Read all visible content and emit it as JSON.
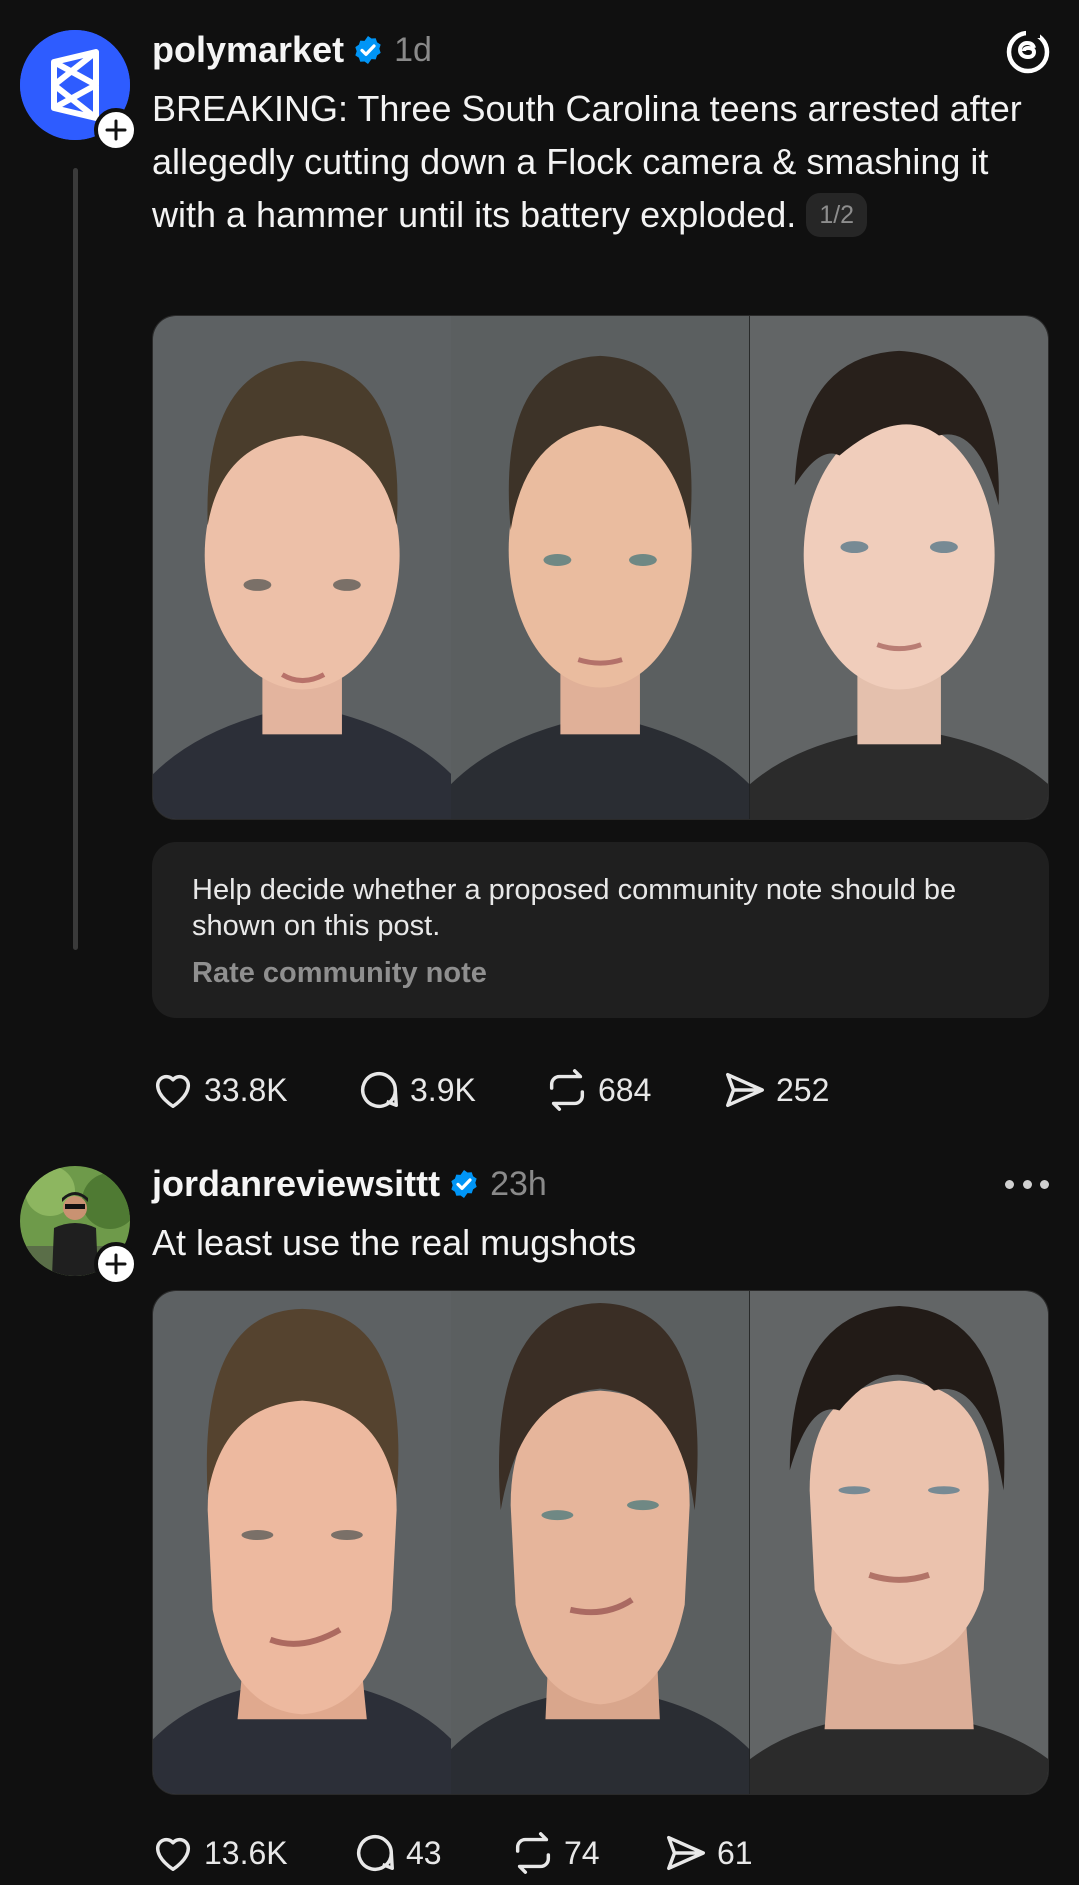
{
  "posts": [
    {
      "username": "polymarket",
      "time": "1d",
      "text": "BREAKING: Three South Carolina teens arrested after allegedly cutting down a Flock camera & smashing it with a hammer until its battery exploded.",
      "pager": "1/2",
      "community_note": {
        "text": "Help decide whether a proposed community note should be shown on this post.",
        "link": "Rate community note"
      },
      "stats": {
        "likes": "33.8K",
        "replies": "3.9K",
        "reposts": "684",
        "shares": "252"
      }
    },
    {
      "username": "jordanreviewsittt",
      "time": "23h",
      "text": "At least use the real mugshots",
      "stats": {
        "likes": "13.6K",
        "replies": "43",
        "reposts": "74",
        "shares": "61"
      }
    }
  ],
  "colors": {
    "background": "#101010",
    "verified": "#0095f6",
    "polymarket_brand": "#2e5cff",
    "muted": "#8a8a8a"
  },
  "icons": [
    "threads-logo-icon",
    "verified-badge-icon",
    "follow-plus-icon",
    "like-heart-icon",
    "reply-bubble-icon",
    "repost-icon",
    "share-send-icon",
    "more-options-icon"
  ]
}
